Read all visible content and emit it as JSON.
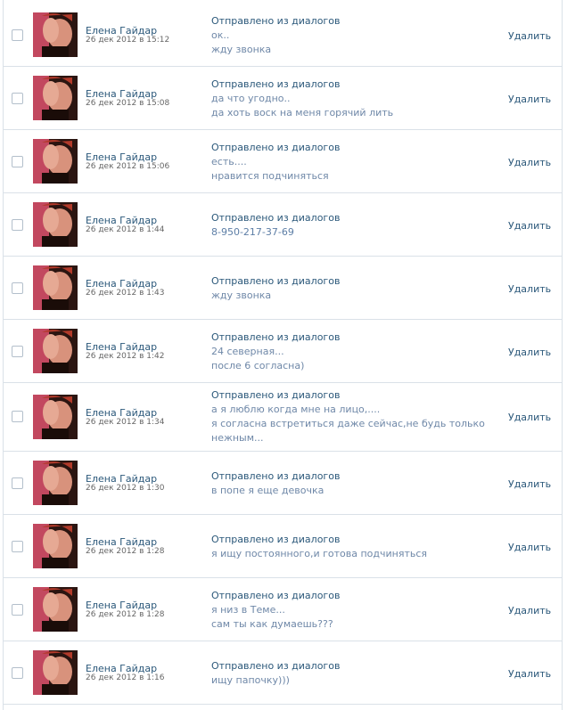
{
  "header": "Отправлено из диалогов",
  "delete_label": "Удалить",
  "messages": [
    {
      "sender": "Елена Гайдар",
      "date": "26 дек 2012 в 15:12",
      "lines": [
        "ок..",
        "жду звонка"
      ]
    },
    {
      "sender": "Елена Гайдар",
      "date": "26 дек 2012 в 15:08",
      "lines": [
        "да что угодно..",
        "да хоть воск на меня горячий лить"
      ]
    },
    {
      "sender": "Елена Гайдар",
      "date": "26 дек 2012 в 15:06",
      "lines": [
        "есть....",
        "нравится подчиняться"
      ]
    },
    {
      "sender": "Елена Гайдар",
      "date": "26 дек 2012 в 1:44",
      "lines": [
        "8-950-217-37-69"
      ]
    },
    {
      "sender": "Елена Гайдар",
      "date": "26 дек 2012 в 1:43",
      "lines": [
        "жду звонка"
      ]
    },
    {
      "sender": "Елена Гайдар",
      "date": "26 дек 2012 в 1:42",
      "lines": [
        "24 северная...",
        "после 6 согласна)"
      ]
    },
    {
      "sender": "Елена Гайдар",
      "date": "26 дек 2012 в 1:34",
      "lines": [
        "а я люблю когда мне на лицо,....",
        "я согласна встретиться даже сейчас,не будь только",
        "нежным..."
      ]
    },
    {
      "sender": "Елена Гайдар",
      "date": "26 дек 2012 в 1:30",
      "lines": [
        "в попе я еще девочка"
      ]
    },
    {
      "sender": "Елена Гайдар",
      "date": "26 дек 2012 в 1:28",
      "lines": [
        "я ищу постоянного,и готова подчиняться"
      ]
    },
    {
      "sender": "Елена Гайдар",
      "date": "26 дек 2012 в 1:28",
      "lines": [
        "я низ в Теме...",
        "сам ты как думаешь???"
      ]
    },
    {
      "sender": "Елена Гайдар",
      "date": "26 дек 2012 в 1:16",
      "lines": [
        "ищу папочку)))"
      ]
    }
  ]
}
